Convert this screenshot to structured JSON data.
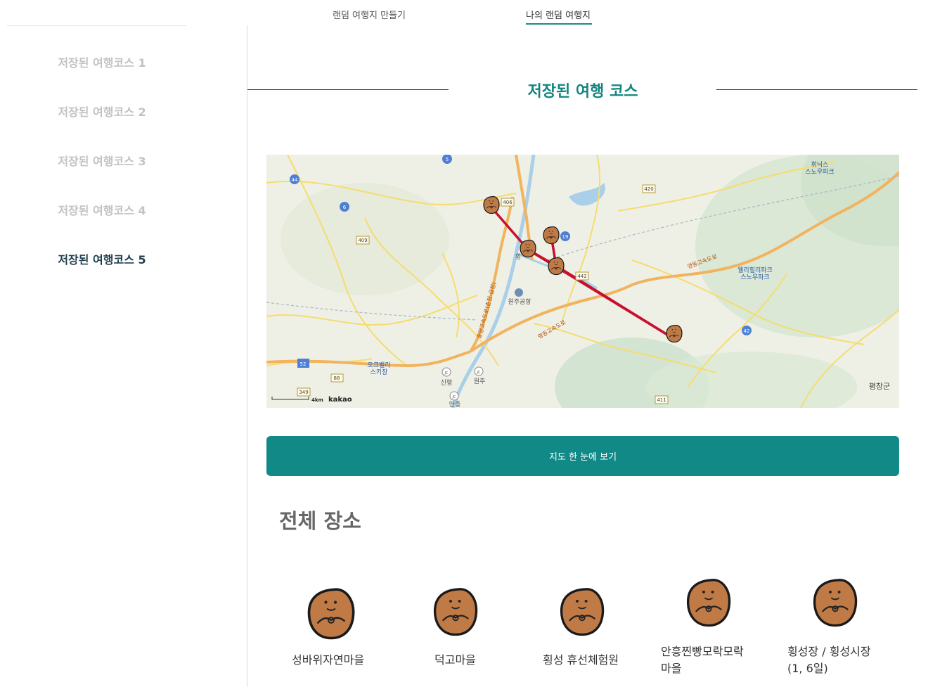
{
  "nav": {
    "tabs": [
      {
        "label": "랜덤 여행지 만들기"
      },
      {
        "label": "나의 랜덤 여행지"
      }
    ]
  },
  "sidebar": {
    "items": [
      {
        "label": "저장된 여행코스 1"
      },
      {
        "label": "저장된 여행코스 2"
      },
      {
        "label": "저장된 여행코스 3"
      },
      {
        "label": "저장된 여행코스 4"
      },
      {
        "label": "저장된 여행코스 5"
      }
    ],
    "active_index": 4
  },
  "main": {
    "title": "저장된 여행 코스",
    "view_button": "지도 한 눈에 보기",
    "places_title": "전체 장소",
    "places": [
      {
        "name": "성바위자연마을"
      },
      {
        "name": "덕고마을"
      },
      {
        "name": "횡성 휴선체험원"
      },
      {
        "name": "안흥찐빵모락모락\n마을"
      },
      {
        "name": "횡성장 / 횡성시장\n(1, 6일)"
      }
    ]
  },
  "map": {
    "labels": {
      "ski1": "휘닉스\n스노우파크",
      "ski2": "웰리힐리파크\n스노우파크",
      "ski3": "오크밸리\n스키장",
      "airport": "원주공항",
      "town_hoeng": "횡",
      "sinpyeong": "신평",
      "wonju": "원주",
      "manjong": "만종",
      "pyeongchang": "평창군",
      "expressway1": "영동고속도로",
      "expressway2": "중앙고속도로(춘천-금정)",
      "expressway3": "영동고속도로"
    },
    "road_shields": [
      "44",
      "6",
      "5",
      "406",
      "409",
      "420",
      "19",
      "442",
      "42",
      "52",
      "88",
      "349",
      "411",
      "JC",
      "JC",
      "JC"
    ],
    "scale_label": "4km",
    "brand": "kakao",
    "route_color": "#c8102e",
    "marker_icon": "potato-mascot-icon"
  },
  "colors": {
    "accent": "#118a87",
    "title": "#12857f",
    "sidebar_active": "#1e3d4a",
    "sidebar_inactive": "#c2c2c2",
    "potato": "#c07a45"
  }
}
